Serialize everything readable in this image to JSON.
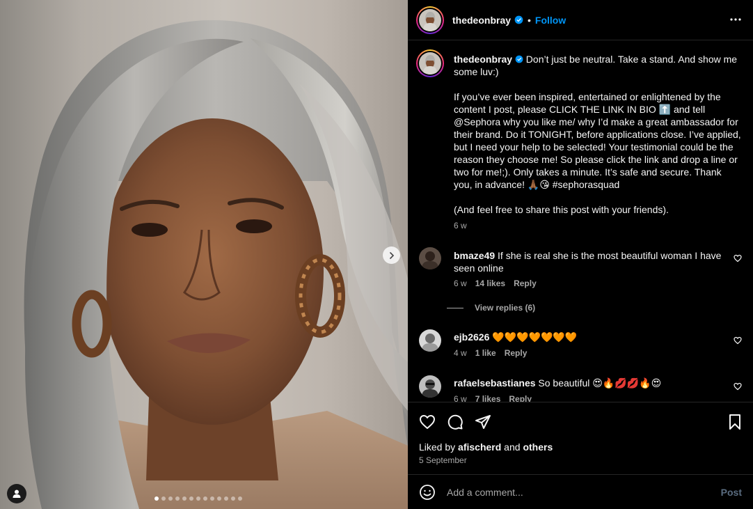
{
  "post": {
    "username": "thedeonbray",
    "follow_label": "Follow",
    "separator": "•",
    "caption_p1": "Don’t just be neutral. Take a stand. And show me some luv:)",
    "caption_p2": "If you’ve ever been inspired, entertained or enlightened by the content I post, please CLICK THE LINK IN BIO ⬆️ and tell @Sephora why you like me/ why I’d make a great ambassador for their brand. Do it TONIGHT, before applications close. I’ve applied, but I need your help to be selected! Your testimonial could be the reason they choose me! So please click the link and drop a line or two for me!;). Only takes a minute. It’s safe and secure. Thank you, in advance! 🙏🏾😘 #sephorasquad",
    "caption_p3": "(And feel free to share this post with your friends).",
    "caption_time": "6 w",
    "liked_by_prefix": "Liked by ",
    "liked_by_user": "afischerd",
    "liked_by_and": " and ",
    "liked_by_others": "others",
    "date": "5 September",
    "carousel_slides": 13,
    "carousel_active": 1
  },
  "comments": [
    {
      "user": "bmaze49",
      "text": "If she is real she is the most beautiful woman I have seen online",
      "time": "6 w",
      "likes": "14 likes",
      "reply": "Reply",
      "view_replies": "View replies (6)"
    },
    {
      "user": "ejb2626",
      "text": "🧡🧡🧡🧡🧡🧡🧡",
      "time": "4 w",
      "likes": "1 like",
      "reply": "Reply"
    },
    {
      "user": "rafaelsebastianes",
      "text": "So beautiful 😍🔥💋💋🔥😍",
      "time": "6 w",
      "likes": "7 likes",
      "reply": "Reply"
    }
  ],
  "composer": {
    "placeholder": "Add a comment...",
    "post_label": "Post"
  },
  "colors": {
    "accent": "#0095f6",
    "background": "#000000",
    "muted": "#a8a8a8"
  },
  "icons": [
    "more-icon",
    "verified-icon",
    "heart-icon",
    "comment-icon",
    "share-icon",
    "bookmark-icon",
    "emoji-icon",
    "next-icon",
    "user-tag-icon"
  ]
}
